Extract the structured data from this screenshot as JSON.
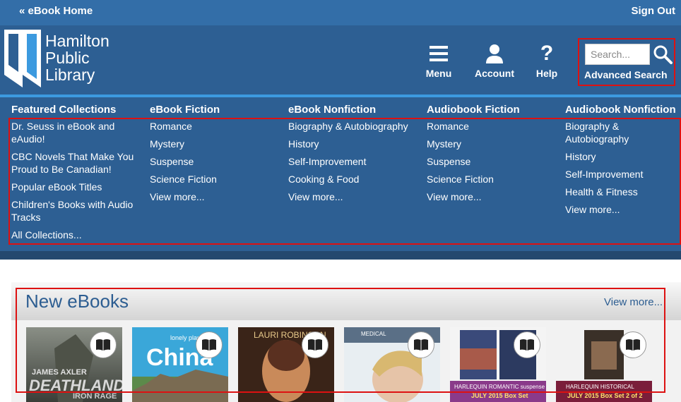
{
  "topbar": {
    "home_label": "« eBook Home",
    "signout_label": "Sign Out"
  },
  "logo": {
    "lines": [
      "Hamilton",
      "Public",
      "Library"
    ]
  },
  "header": {
    "menu_label": "Menu",
    "account_label": "Account",
    "help_label": "Help",
    "search_placeholder": "Search...",
    "advanced_search_label": "Advanced Search"
  },
  "menu": {
    "columns": [
      {
        "title": "Featured Collections",
        "items": [
          "Dr. Seuss in eBook and eAudio!",
          "CBC Novels That Make You Proud to Be Canadian!",
          "Popular eBook Titles",
          "Children's Books with Audio Tracks",
          "All Collections..."
        ]
      },
      {
        "title": "eBook Fiction",
        "items": [
          "Romance",
          "Mystery",
          "Suspense",
          "Science Fiction",
          "View more..."
        ]
      },
      {
        "title": "eBook Nonfiction",
        "items": [
          "Biography & Autobiography",
          "History",
          "Self-Improvement",
          "Cooking & Food",
          "View more..."
        ]
      },
      {
        "title": "Audiobook Fiction",
        "items": [
          "Romance",
          "Mystery",
          "Suspense",
          "Science Fiction",
          "View more..."
        ]
      },
      {
        "title": "Audiobook Nonfiction",
        "items": [
          "Biography & Autobiography",
          "History",
          "Self-Improvement",
          "Health & Fitness",
          "View more..."
        ]
      }
    ]
  },
  "new_ebooks": {
    "title": "New eBooks",
    "view_more": "View more...",
    "books": [
      {
        "cover_text": [
          "JAMES AXLER",
          "DEATHLANDS",
          "IRON RAGE"
        ],
        "icon": "book-icon"
      },
      {
        "cover_text": [
          "lonely planet",
          "China"
        ],
        "icon": "book-icon"
      },
      {
        "cover_text": [
          "LAURI ROBINSON"
        ],
        "icon": "book-icon"
      },
      {
        "cover_text": [
          "MEDICAL"
        ],
        "icon": "book-icon"
      },
      {
        "cover_text": [
          "HARLEQUIN ROMANTIC suspense",
          "JULY 2015 Box Set"
        ],
        "icon": "book-icon"
      },
      {
        "cover_text": [
          "HARLEQUIN HISTORICAL",
          "JULY 2015 Box Set 2 of 2"
        ],
        "icon": "book-icon"
      }
    ]
  },
  "colors": {
    "topbar": "#336ea8",
    "header": "#2d5f93",
    "accent": "#3c9adf",
    "highlight": "#dd1111",
    "title": "#2c5d91"
  }
}
